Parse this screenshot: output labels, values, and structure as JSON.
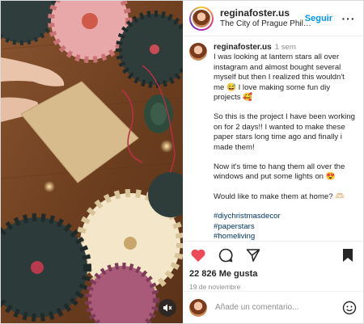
{
  "header": {
    "username": "reginafoster.us",
    "location": "The City of Prague Philharmon…",
    "follow_label": "Seguir",
    "more_label": "···"
  },
  "caption": {
    "username": "reginafoster.us",
    "time": "1 sem",
    "p1": "I was looking at lantern stars all over instagram and almost bought several myself but then I realized this wouldn't me 😅 I love making some fun diy projects 🥰",
    "p2": "So this is the project I have been working on for 2 days!! I wanted to make these paper stars long time ago and finally i made them!",
    "p3": "Now it's time to hang them all over the windows and put some lights on 😍",
    "p4": "Would like to make them at home? 🫶🏻",
    "hashtags": [
      "#diychristmasdecor",
      "#paperstars",
      "#homeliving"
    ]
  },
  "actions": {
    "icons": [
      "heart-filled-icon",
      "comment-icon",
      "share-icon",
      "bookmark-icon"
    ],
    "like_color": "#ed4956"
  },
  "likes_label": "22 826 Me gusta",
  "date_label": "19 de noviembre",
  "comment": {
    "placeholder": "Añade un comentario..."
  },
  "media": {
    "icon": "speaker-muted-icon"
  },
  "colors": {
    "accent": "#0095f6",
    "hashtag": "#00376b",
    "muted_text": "#8e8e8e"
  }
}
